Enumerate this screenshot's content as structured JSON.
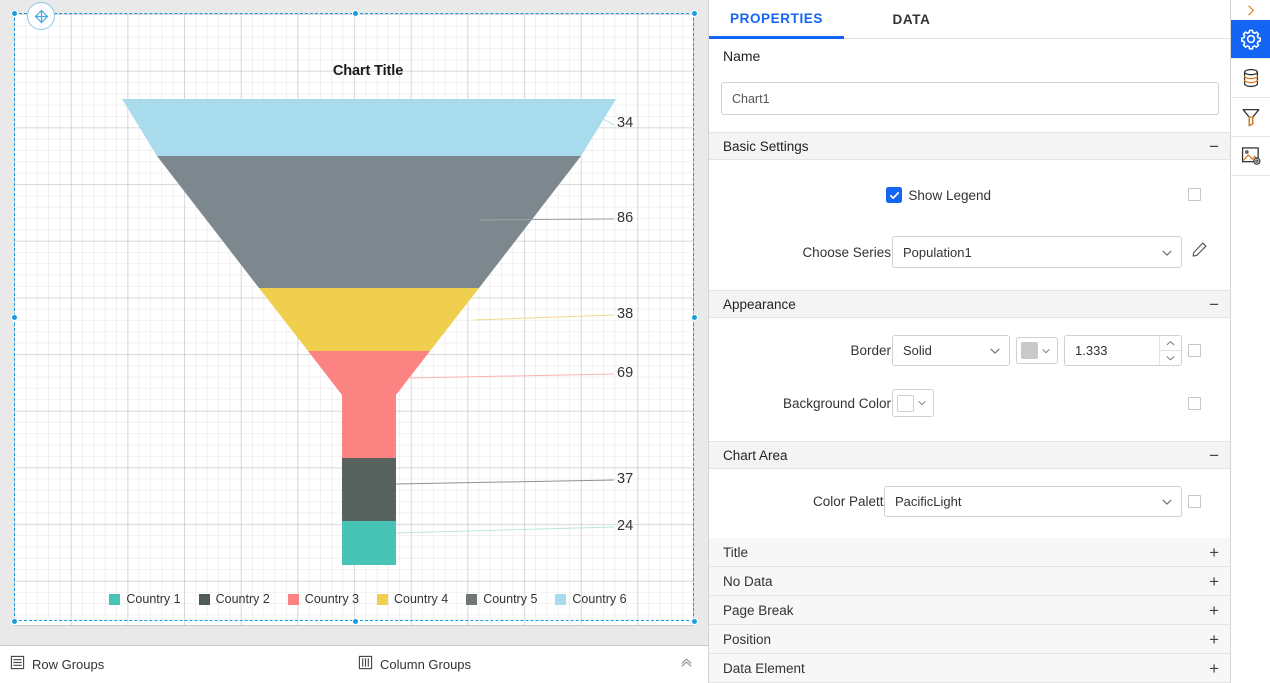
{
  "design_surface": {
    "move_handle_icon": "move-cross-icon"
  },
  "chart": {
    "title": "Chart Title",
    "type": "funnel",
    "legend_position": "bottom"
  },
  "chart_data": {
    "type": "bar",
    "chart_kind": "funnel",
    "title": "Chart Title",
    "xlabel": "",
    "ylabel": "",
    "categories": [
      "Country 6",
      "Country 5",
      "Country 4",
      "Country 3",
      "Country 2",
      "Country 1"
    ],
    "values": [
      34,
      86,
      38,
      69,
      37,
      24
    ],
    "colors": [
      "#a8dcec",
      "#7c878e",
      "#efcf4d",
      "#fb8382",
      "#58625f",
      "#48c4b7"
    ],
    "legend": [
      {
        "label": "Country 1",
        "color": "#48c4b7"
      },
      {
        "label": "Country 2",
        "color": "#4f5b5a"
      },
      {
        "label": "Country 3",
        "color": "#fb8382"
      },
      {
        "label": "Country 4",
        "color": "#efcf4d"
      },
      {
        "label": "Country 5",
        "color": "#6f7674"
      },
      {
        "label": "Country 6",
        "color": "#a8dcec"
      }
    ],
    "data_labels": [
      "34",
      "86",
      "38",
      "69",
      "37",
      "24"
    ],
    "grid": true,
    "legend_position": "bottom"
  },
  "bottom_bar": {
    "row_groups": "Row Groups",
    "column_groups": "Column Groups",
    "row_groups_icon": "rows-icon",
    "column_groups_icon": "columns-icon",
    "collapse_icon": "chevron-up-icon"
  },
  "properties_panel": {
    "tabs": [
      {
        "label": "PROPERTIES",
        "active": true
      },
      {
        "label": "DATA",
        "active": false
      }
    ],
    "name_label": "Name",
    "name_value": "Chart1",
    "name_placeholder": "Chart1",
    "sections": {
      "basic_settings": {
        "title": "Basic Settings",
        "toggle": "−",
        "show_legend_label": "Show Legend",
        "show_legend_checked": true,
        "choose_series_label": "Choose Series",
        "choose_series_value": "Population1",
        "edit_icon": "pencil-icon"
      },
      "appearance": {
        "title": "Appearance",
        "toggle": "−",
        "border_label": "Border",
        "border_style": "Solid",
        "border_color": "#c9c9c9",
        "border_width": "1.333",
        "background_color_label": "Background Color",
        "background_color": "#ffffff"
      },
      "chart_area": {
        "title": "Chart Area",
        "toggle": "−",
        "color_palette_label": "Color Palette",
        "color_palette_value": "PacificLight"
      }
    },
    "collapsed_sections": [
      {
        "label": "Title",
        "toggle": "+"
      },
      {
        "label": "No Data",
        "toggle": "+"
      },
      {
        "label": "Page Break",
        "toggle": "+"
      },
      {
        "label": "Position",
        "toggle": "+"
      },
      {
        "label": "Data Element",
        "toggle": "+"
      }
    ]
  },
  "icon_rail": {
    "expand_icon": "chevron-right-icon",
    "items": [
      {
        "icon": "gear-icon",
        "active": true
      },
      {
        "icon": "database-icon",
        "active": false
      },
      {
        "icon": "filter-icon",
        "active": false
      },
      {
        "icon": "image-settings-icon",
        "active": false
      }
    ]
  },
  "theme": {
    "accent": "#1565f5",
    "selection": "#1b9ce0"
  }
}
